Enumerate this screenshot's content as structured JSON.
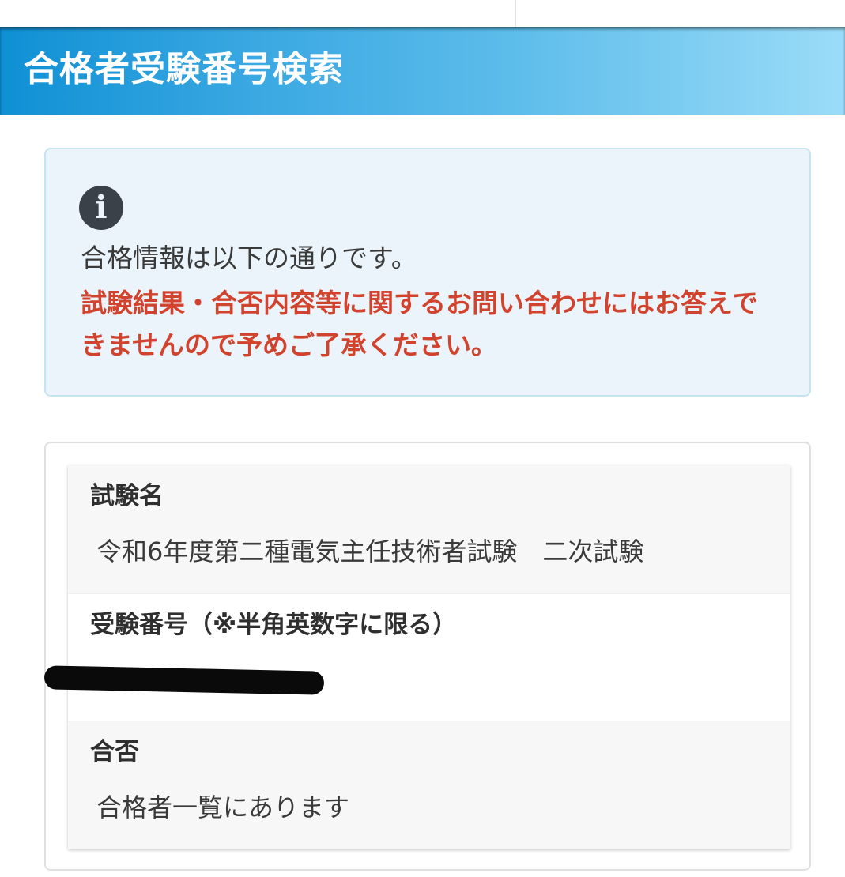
{
  "page": {
    "title": "合格者受験番号検索"
  },
  "info": {
    "icon": "info-circle-icon",
    "message": "合格情報は以下の通りです。",
    "warning": "試験結果・合否内容等に関するお問い合わせにはお答えできませんので予めご了承ください。",
    "warning_color": "#d2432e"
  },
  "result": {
    "rows": [
      {
        "label": "試験名",
        "value": "令和6年度第二種電気主任技術者試験　二次試験"
      },
      {
        "label": "受験番号（※半角英数字に限る）",
        "value": ""
      },
      {
        "label": "合否",
        "value": "合格者一覧にあります"
      }
    ]
  },
  "colors": {
    "header_start": "#0f90d4",
    "header_end": "#9bdcf8",
    "info_bg": "#ebf4fa"
  }
}
